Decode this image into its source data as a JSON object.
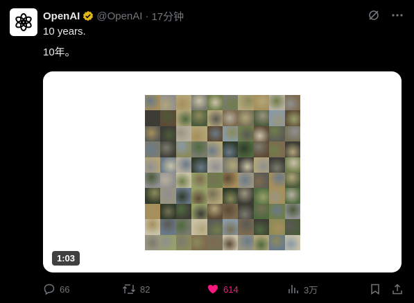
{
  "tweet": {
    "author": "OpenAI",
    "handle": "@OpenAI",
    "dot": "·",
    "time": "17分钟",
    "text_line1": "10 years.",
    "text_line2": "10年。"
  },
  "media": {
    "duration": "1:03"
  },
  "actions": {
    "replies": "66",
    "retweets": "82",
    "likes": "614",
    "views": "3万"
  },
  "colors": {
    "background": "#000000",
    "text": "#e7e9ea",
    "muted": "#71767b",
    "like": "#f91880",
    "verified": "#e2b719"
  }
}
